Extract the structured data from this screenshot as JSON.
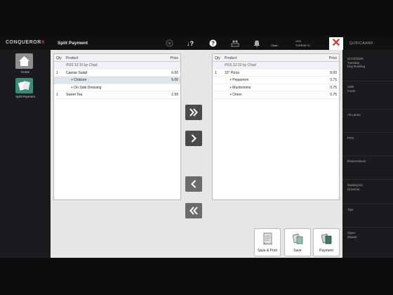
{
  "app": {
    "logo_main": "CONQUEROR",
    "logo_x": "X",
    "title": "Split Payment",
    "brand": "QUBICAAMF"
  },
  "topbar": {
    "help": "?",
    "user": "Chad",
    "date": "12/11",
    "day": "TUESDAY 31"
  },
  "sidebar": {
    "items": [
      {
        "label": "Home"
      },
      {
        "label": "Split Payment"
      }
    ]
  },
  "left_panel": {
    "headers": {
      "qty": "Qty",
      "product": "Product",
      "price": "Price"
    },
    "rows": [
      {
        "qty": "",
        "product": "POS 12:10 by Chad",
        "price": "",
        "kind": "header"
      },
      {
        "qty": "1",
        "product": "Caesar Salad",
        "price": "6.00",
        "kind": "item"
      },
      {
        "qty": "",
        "product": "+ Chicken",
        "price": "5.00",
        "kind": "sel"
      },
      {
        "qty": "",
        "product": "+ On Side Dressing",
        "price": "",
        "kind": "item"
      },
      {
        "qty": "1",
        "product": "Sweet Tea",
        "price": "2.99",
        "kind": "item"
      }
    ]
  },
  "right_panel": {
    "headers": {
      "qty": "Qty",
      "product": "Product",
      "price": "Price"
    },
    "rows": [
      {
        "qty": "",
        "product": "POS 12:10 by Chad",
        "price": "",
        "kind": "header"
      },
      {
        "qty": "1",
        "product": "10\" Pizza",
        "price": "8.00",
        "kind": "item"
      },
      {
        "qty": "",
        "product": "+ Pepperoni",
        "price": "0.75",
        "kind": "item"
      },
      {
        "qty": "",
        "product": "+ Mushrooms",
        "price": "0.75",
        "kind": "item"
      },
      {
        "qty": "",
        "product": "+ Onion",
        "price": "0.75",
        "kind": "item"
      }
    ]
  },
  "actions": {
    "save_print": "Save & Print",
    "save": "Save",
    "payment": "Payment"
  },
  "right_sidebar": {
    "items": [
      {
        "lines": [
          "01/12/2020",
          "Tuesday",
          "Day Bowling"
        ]
      },
      {
        "lines": [
          "Safe",
          "mode"
        ]
      },
      {
        "lines": [
          "All Lanes"
        ]
      },
      {
        "lines": [
          "POS"
        ]
      },
      {
        "lines": [
          "Reservations"
        ]
      },
      {
        "lines": [
          "Waiting list",
          "(0 items)"
        ]
      },
      {
        "lines": [
          "Tips"
        ]
      },
      {
        "lines": [
          "Open",
          "drawer"
        ]
      }
    ]
  }
}
